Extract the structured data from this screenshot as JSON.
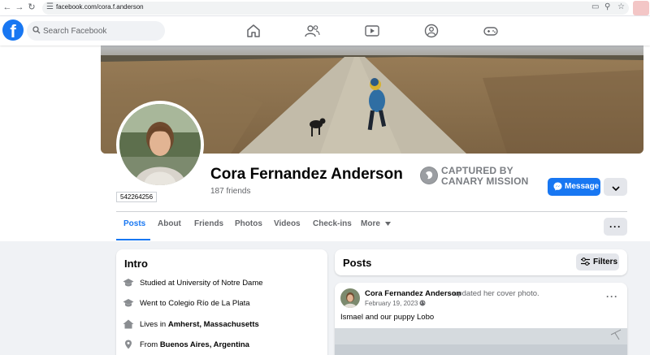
{
  "browser": {
    "url": "facebook.com/cora.f.anderson",
    "icons": [
      "back-icon",
      "forward-icon",
      "reload-icon",
      "site-settings-icon",
      "cast-icon",
      "zoom-icon",
      "bookmark-star-icon"
    ]
  },
  "header": {
    "logo_letter": "f",
    "search_placeholder": "Search Facebook",
    "nav_icons": [
      "home-icon",
      "friends-icon",
      "watch-icon",
      "groups-icon",
      "gaming-icon"
    ]
  },
  "profile": {
    "name": "Cora Fernandez Anderson",
    "friends": "187 friends",
    "id_badge": "542264256",
    "watermark": {
      "line1": "CAPTURED BY",
      "line2": "CANARY MISSION"
    },
    "message_label": "Message"
  },
  "tabs": [
    {
      "label": "Posts",
      "active": true
    },
    {
      "label": "About"
    },
    {
      "label": "Friends"
    },
    {
      "label": "Photos"
    },
    {
      "label": "Videos"
    },
    {
      "label": "Check-ins"
    },
    {
      "label": "More"
    }
  ],
  "intro": {
    "title": "Intro",
    "items": [
      {
        "icon": "graduation-cap-icon",
        "prefix": "Studied at University of Notre Dame",
        "bold": ""
      },
      {
        "icon": "graduation-cap-icon",
        "prefix": "Went to Colegio Río de La Plata",
        "bold": ""
      },
      {
        "icon": "home-icon",
        "prefix": "Lives in ",
        "bold": "Amherst, Massachusetts"
      },
      {
        "icon": "location-pin-icon",
        "prefix": "From ",
        "bold": "Buenos Aires, Argentina"
      }
    ]
  },
  "posts": {
    "title": "Posts",
    "filters_label": "Filters",
    "post": {
      "author": "Cora Fernandez Anderson",
      "action": "updated her cover photo.",
      "date": "February 19, 2023 ·",
      "text": "Ismael and our puppy Lobo",
      "menu": "···"
    }
  },
  "more_dots": "···",
  "colors": {
    "brand": "#1877f2",
    "page_bg": "#f0f2f5",
    "secondary_text": "#65676b"
  }
}
